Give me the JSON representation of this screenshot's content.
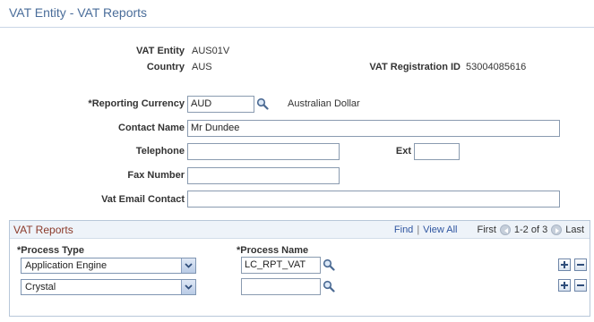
{
  "page": {
    "title": "VAT Entity - VAT Reports"
  },
  "entity": {
    "vat_entity_label": "VAT Entity",
    "vat_entity_value": "AUS01V",
    "country_label": "Country",
    "country_value": "AUS",
    "vat_reg_label": "VAT Registration ID",
    "vat_reg_value": "53004085616"
  },
  "form": {
    "currency_label": "*Reporting Currency",
    "currency_value": "AUD",
    "currency_desc": "Australian Dollar",
    "contact_label": "Contact Name",
    "contact_value": "Mr Dundee",
    "telephone_label": "Telephone",
    "telephone_value": "",
    "ext_label": "Ext",
    "ext_value": "",
    "fax_label": "Fax Number",
    "fax_value": "",
    "email_label": "Vat Email Contact",
    "email_value": ""
  },
  "grid": {
    "title": "VAT Reports",
    "find_label": "Find",
    "separator": "|",
    "view_all_label": "View All",
    "first_label": "First",
    "range_label": "1-2 of 3",
    "last_label": "Last",
    "col_process_type": "*Process Type",
    "col_process_name": "*Process Name",
    "rows": [
      {
        "process_type": "Application Engine",
        "process_name": "LC_RPT_VAT"
      },
      {
        "process_type": "Crystal",
        "process_name": ""
      }
    ]
  },
  "icons": {
    "lookup": "magnifier-icon",
    "dropdown": "chevron-down-icon",
    "add_row": "plus-icon",
    "delete_row": "minus-icon",
    "prev": "left-arrow-icon",
    "next": "right-arrow-icon"
  },
  "colors": {
    "title": "#4a6d9a",
    "grid_title": "#8b3a2a",
    "link": "#3056a0"
  }
}
